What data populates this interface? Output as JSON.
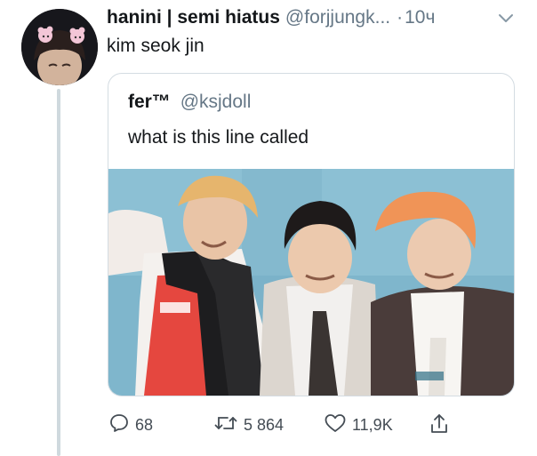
{
  "tweet": {
    "display_name": "hanini | semi hiatus",
    "handle": "@forjjungk...",
    "separator": "·",
    "time": "10ч",
    "text": "kim seok jin"
  },
  "quoted_tweet": {
    "display_name": "fer™",
    "handle": "@ksjdoll",
    "text": "what is this line called"
  },
  "actions": {
    "replies": "68",
    "retweets": "5 864",
    "likes": "11,9K"
  },
  "icons": {
    "reply": "reply-bubble-icon",
    "retweet": "retweet-arrows-icon",
    "like": "heart-icon",
    "share": "share-upload-icon",
    "menu": "chevron-down-icon"
  },
  "colors": {
    "text": "#14171a",
    "secondary": "#657786",
    "border": "#d4dce2",
    "thread_line": "#cfd9de"
  }
}
